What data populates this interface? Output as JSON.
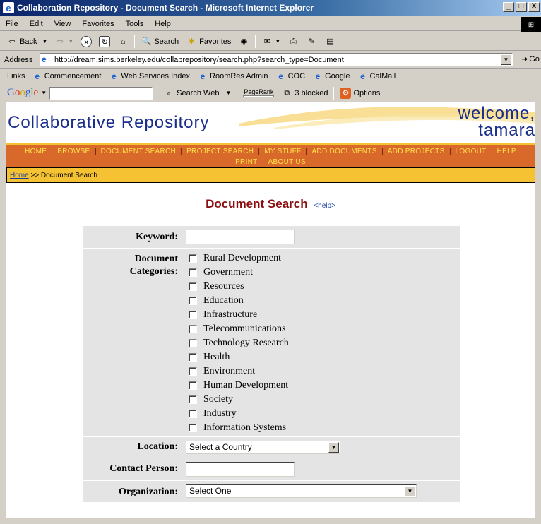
{
  "window": {
    "title": "Collaboration Repository - Document Search - Microsoft Internet Explorer",
    "buttons": {
      "minimize": "_",
      "maximize": "□",
      "close": "X"
    }
  },
  "menu": [
    "File",
    "Edit",
    "View",
    "Favorites",
    "Tools",
    "Help"
  ],
  "toolbar": {
    "back": "Back",
    "search": "Search",
    "favorites": "Favorites"
  },
  "address": {
    "label": "Address",
    "url": "http://dream.sims.berkeley.edu/collabrepository/search.php?search_type=Document",
    "go": "Go"
  },
  "links": {
    "label": "Links",
    "items": [
      "Commencement",
      "Web Services Index",
      "RoomRes Admin",
      "COC",
      "Google",
      "CalMail"
    ]
  },
  "googlebar": {
    "search_web": "Search Web",
    "pagerank": "PageRank",
    "blocked": "3 blocked",
    "options": "Options"
  },
  "site": {
    "title": "Collaborative Repository",
    "welcome_line1": "welcome,",
    "welcome_line2": "tamara",
    "nav_row1": [
      "HOME",
      "BROWSE",
      "DOCUMENT SEARCH",
      "PROJECT SEARCH",
      "MY STUFF",
      "ADD DOCUMENTS",
      "ADD PROJECTS",
      "LOGOUT",
      "HELP"
    ],
    "nav_row2": [
      "PRINT",
      "ABOUT US"
    ],
    "breadcrumb": {
      "home": "Home",
      "rest": " >> Document Search"
    }
  },
  "search": {
    "title": "Document Search",
    "help": "<help>",
    "keyword_label": "Keyword:",
    "categories_label_1": "Document",
    "categories_label_2": "Categories:",
    "categories": [
      "Rural Development",
      "Government",
      "Resources",
      "Education",
      "Infrastructure",
      "Telecommunications",
      "Technology Research",
      "Health",
      "Environment",
      "Human Development",
      "Society",
      "Industry",
      "Information Systems"
    ],
    "location_label": "Location:",
    "location_value": "Select a Country",
    "contact_label": "Contact Person:",
    "organization_label": "Organization:",
    "organization_value": "Select One"
  }
}
